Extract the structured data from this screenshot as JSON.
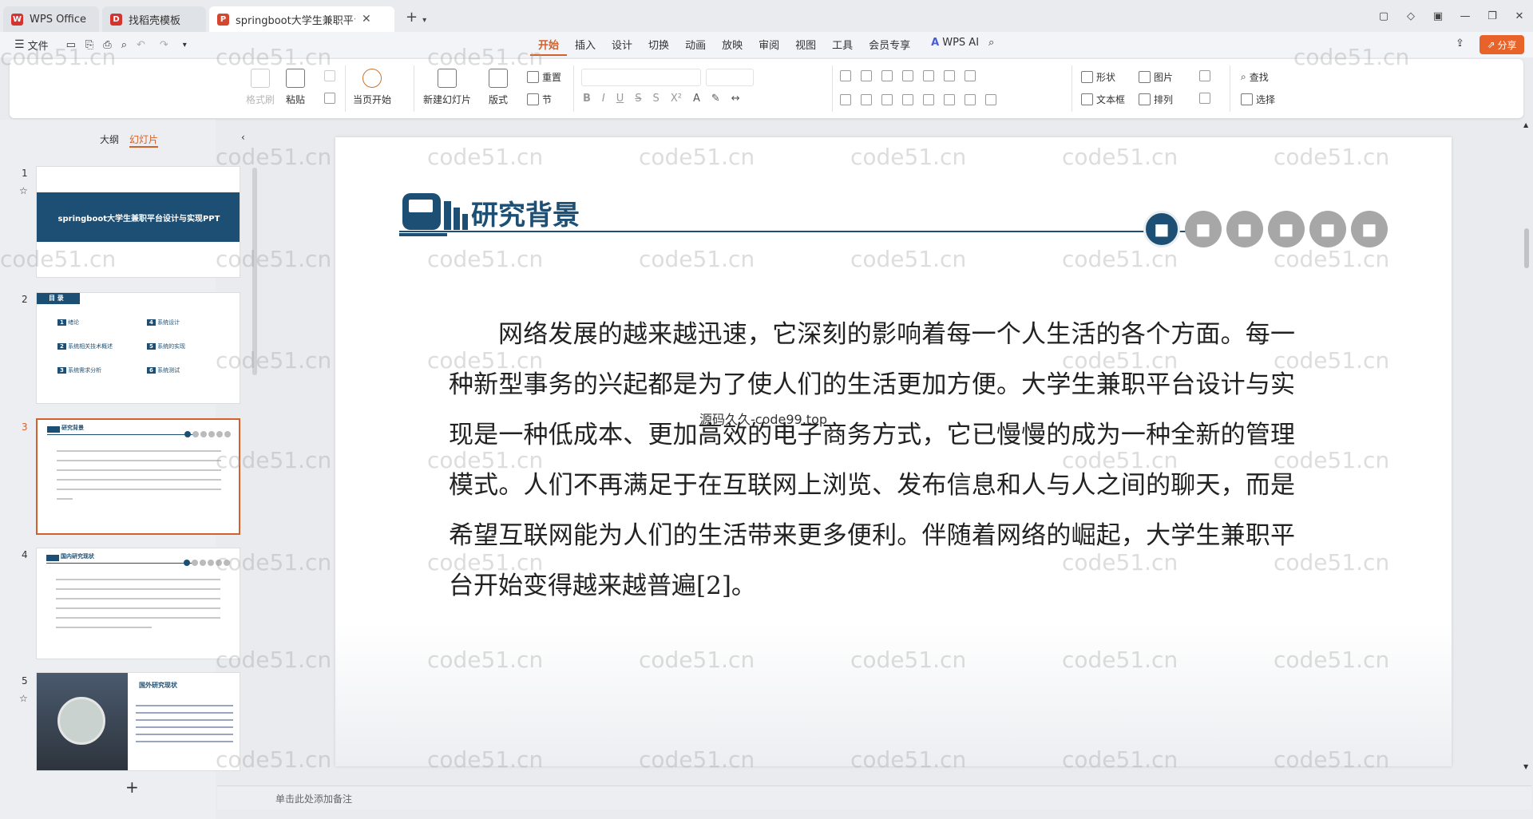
{
  "tabs": [
    {
      "label": "WPS Office",
      "color": "#d6322e",
      "glyph": "W"
    },
    {
      "label": "找稻壳模板",
      "color": "#d6322e",
      "glyph": "D"
    },
    {
      "label": "springboot大学生兼职平台",
      "color": "#d6462f",
      "glyph": "P"
    }
  ],
  "menu": {
    "file": "文件",
    "tabs": [
      "开始",
      "插入",
      "设计",
      "切换",
      "动画",
      "放映",
      "审阅",
      "视图",
      "工具",
      "会员专享"
    ],
    "ai": "WPS AI",
    "share": "分享"
  },
  "ribbon": {
    "format_brush": "格式刷",
    "paste": "粘贴",
    "play_from_current": "当页开始",
    "new_slide": "新建幻灯片",
    "layout": "版式",
    "reset": "重置",
    "section": "节",
    "shape": "形状",
    "picture": "图片",
    "find": "查找",
    "textbox": "文本框",
    "arrange": "排列",
    "select": "选择",
    "font_buttons": [
      "B",
      "I",
      "U",
      "S",
      "X²"
    ]
  },
  "left_panel": {
    "tab_outline": "大纲",
    "tab_slides": "幻灯片",
    "add": "+",
    "slides": [
      {
        "num": "1",
        "title": "springboot大学生兼职平台设计与实现PPT"
      },
      {
        "num": "2",
        "label": "目 录",
        "items": [
          "绪论",
          "系统相关技术概述",
          "系统需求分析",
          "系统设计",
          "系统的实现",
          "系统测试"
        ],
        "item_nums": [
          "1",
          "2",
          "3",
          "4",
          "5",
          "6"
        ]
      },
      {
        "num": "3",
        "title": "研究背景"
      },
      {
        "num": "4",
        "title": "国内研究现状"
      },
      {
        "num": "5",
        "title": "国外研究现状"
      }
    ]
  },
  "slide": {
    "title": "研究背景",
    "paragraph": "网络发展的越来越迅速，它深刻的影响着每一个人生活的各个方面。每一种新型事务的兴起都是为了使人们的生活更加方便。大学生兼职平台设计与实现是一种低成本、更加高效的电子商务方式，它已慢慢的成为一种全新的管理模式。人们不再满足于在互联网上浏览、发布信息和人与人之间的聊天，而是希望互联网能为人们的生活带来更多便利。伴随着网络的崛起，大学生兼职平台开始变得越来越普遍[2]。",
    "overlay": "源码久久-code99.top",
    "accent": "#1c4f73"
  },
  "notes": {
    "placeholder": "单击此处添加备注"
  },
  "watermark": "code51.cn"
}
